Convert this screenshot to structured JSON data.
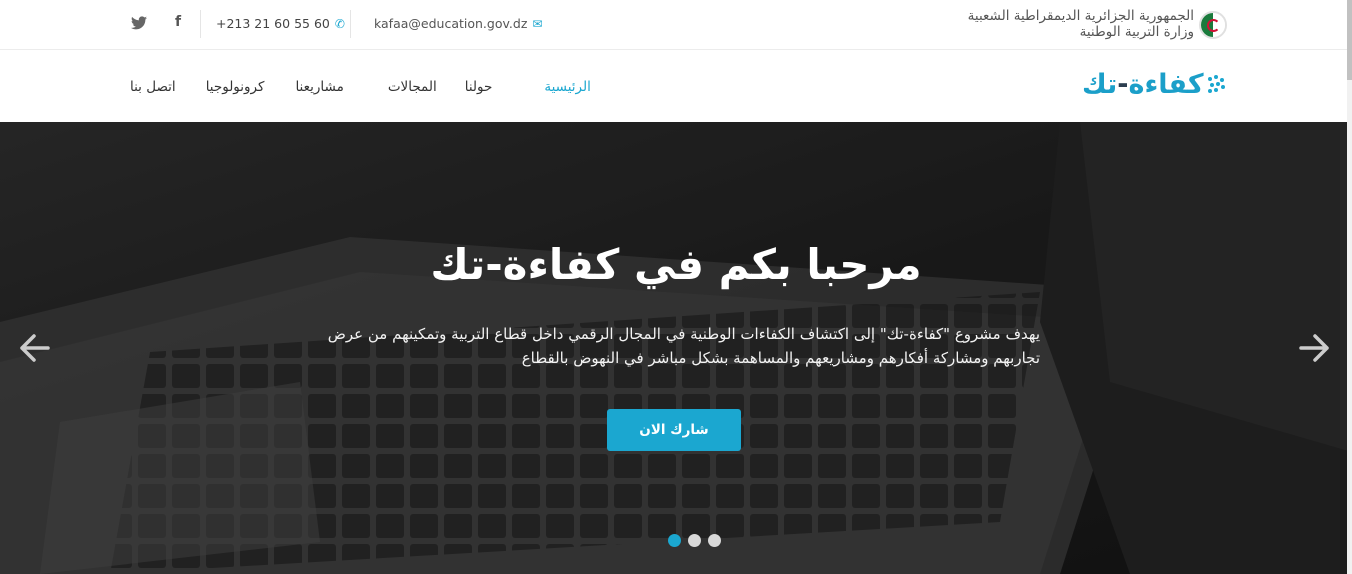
{
  "topbar": {
    "gov_line1": "الجمهورية الجزائرية الديمقراطية الشعبية",
    "gov_line2": "وزارة التربية الوطنية",
    "email": "kafaa@education.gov.dz",
    "phone": "+213 21 60 55 60",
    "icons": [
      "algeria-flag-icon",
      "envelope-icon",
      "phone-icon",
      "facebook-icon",
      "twitter-icon"
    ]
  },
  "logo": {
    "text_main": "كفاءة",
    "text_dash": "-",
    "text_end": "تك"
  },
  "nav": {
    "items": [
      {
        "label": "الرئيسية",
        "active": true
      },
      {
        "label": "حولنا",
        "active": false
      },
      {
        "label": "المجالات",
        "active": false
      },
      {
        "label": "مشاريعنا",
        "active": false
      },
      {
        "label": "كرونولوجيا",
        "active": false
      },
      {
        "label": "اتصل بنا",
        "active": false
      }
    ]
  },
  "hero": {
    "title": "مرحبا بكم في كفاءة-تك",
    "description": "يهدف مشروع \"كفاءة-تك\" إلى اكتشاف الكفاءات الوطنية في المجال الرقمي داخل قطاع التربية وتمكينهم من عرض تجاربهم ومشاركة أفكارهم ومشاريعهم والمساهمة بشكل مباشر في النهوض بالقطاع",
    "cta_label": "شارك الان",
    "slides_total": 3,
    "active_slide": 1
  },
  "colors": {
    "accent": "#1ba7d0",
    "text": "#333333",
    "hero_overlay": "#1f1f1f"
  }
}
